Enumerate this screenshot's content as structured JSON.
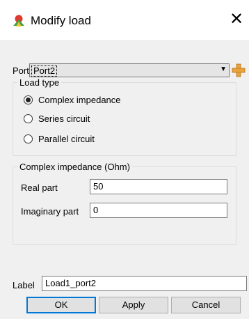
{
  "window": {
    "title": "Modify load",
    "close_glyph": "✕"
  },
  "port": {
    "label": "Port",
    "selected": "Port2",
    "arrow": "▼"
  },
  "load_type": {
    "legend": "Load type",
    "options": [
      {
        "label": "Complex impedance",
        "selected": true
      },
      {
        "label": "Series circuit",
        "selected": false
      },
      {
        "label": "Parallel circuit",
        "selected": false
      }
    ]
  },
  "impedance": {
    "legend": "Complex impedance (Ohm)",
    "real_label": "Real part",
    "real_value": "50",
    "imag_label": "Imaginary part",
    "imag_value": "0"
  },
  "label_field": {
    "label": "Label",
    "value": "Load1_port2"
  },
  "buttons": {
    "ok": "OK",
    "apply": "Apply",
    "cancel": "Cancel"
  },
  "colors": {
    "default_button_border": "#0078d7",
    "client_bg": "#f0f0f0"
  },
  "icons": {
    "app": "app-logo-icon",
    "add": "add-plus-icon"
  }
}
